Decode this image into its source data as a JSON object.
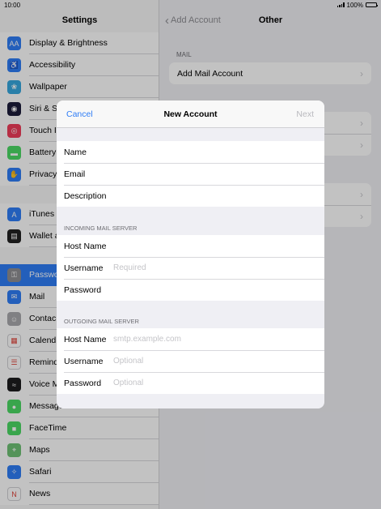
{
  "status": {
    "time": "10:00",
    "battery": "100%"
  },
  "sidebar": {
    "title": "Settings",
    "items": [
      {
        "label": "Display & Brightness",
        "icon": "display-icon",
        "color": "#2f7df6",
        "glyph": "AA"
      },
      {
        "label": "Accessibility",
        "icon": "accessibility-icon",
        "color": "#2f7df6",
        "glyph": "♿"
      },
      {
        "label": "Wallpaper",
        "icon": "wallpaper-icon",
        "color": "#36a8df",
        "glyph": "❀"
      },
      {
        "label": "Siri & S",
        "icon": "siri-icon",
        "color": "#1c1c3a",
        "glyph": "◉"
      },
      {
        "label": "Touch I",
        "icon": "touch-id-icon",
        "color": "#f03d5a",
        "glyph": "◎"
      },
      {
        "label": "Battery",
        "icon": "battery-icon",
        "color": "#4cd964",
        "glyph": "▬"
      },
      {
        "label": "Privacy",
        "icon": "privacy-icon",
        "color": "#2f7df6",
        "glyph": "✋"
      },
      {
        "label": "iTunes",
        "icon": "app-store-icon",
        "color": "#2f7df6",
        "glyph": "A"
      },
      {
        "label": "Wallet a",
        "icon": "wallet-icon",
        "color": "#222",
        "glyph": "▤"
      },
      {
        "label": "Passwo",
        "icon": "passwords-icon",
        "color": "#8e8e93",
        "glyph": "⚿"
      },
      {
        "label": "Mail",
        "icon": "mail-icon",
        "color": "#2f7df6",
        "glyph": "✉"
      },
      {
        "label": "Contac",
        "icon": "contacts-icon",
        "color": "#a9a9ad",
        "glyph": "☺"
      },
      {
        "label": "Calend",
        "icon": "calendar-icon",
        "color": "#ffffff",
        "glyph": "▦"
      },
      {
        "label": "Remind",
        "icon": "reminders-icon",
        "color": "#ffffff",
        "glyph": "☰"
      },
      {
        "label": "Voice M",
        "icon": "voice-memos-icon",
        "color": "#1c1c1e",
        "glyph": "≈"
      },
      {
        "label": "Messages",
        "icon": "messages-icon",
        "color": "#4cd964",
        "glyph": "●"
      },
      {
        "label": "FaceTime",
        "icon": "facetime-icon",
        "color": "#4cd964",
        "glyph": "■"
      },
      {
        "label": "Maps",
        "icon": "maps-icon",
        "color": "#6fc276",
        "glyph": "⌖"
      },
      {
        "label": "Safari",
        "icon": "safari-icon",
        "color": "#2f7df6",
        "glyph": "✧"
      },
      {
        "label": "News",
        "icon": "news-icon",
        "color": "#ffffff",
        "glyph": "N"
      }
    ]
  },
  "detail": {
    "back_label": "Add Account",
    "title": "Other",
    "mail_header": "MAIL",
    "add_mail_label": "Add Mail Account"
  },
  "modal": {
    "cancel_label": "Cancel",
    "title": "New Account",
    "next_label": "Next",
    "account_fields": [
      {
        "label": "Name",
        "value": ""
      },
      {
        "label": "Email",
        "value": ""
      },
      {
        "label": "Description",
        "value": ""
      }
    ],
    "incoming_header": "INCOMING MAIL SERVER",
    "incoming_fields": [
      {
        "label": "Host Name",
        "placeholder": ""
      },
      {
        "label": "Username",
        "placeholder": "Required"
      },
      {
        "label": "Password",
        "placeholder": ""
      }
    ],
    "outgoing_header": "OUTGOING MAIL SERVER",
    "outgoing_fields": [
      {
        "label": "Host Name",
        "placeholder": "smtp.example.com"
      },
      {
        "label": "Username",
        "placeholder": "Optional"
      },
      {
        "label": "Password",
        "placeholder": "Optional"
      }
    ]
  }
}
